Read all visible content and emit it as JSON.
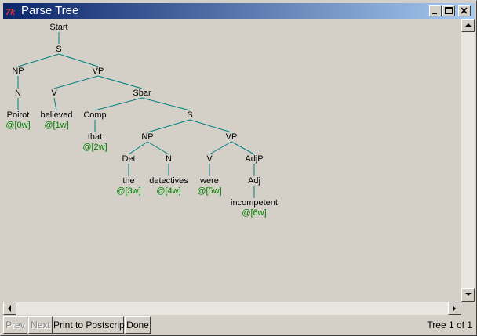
{
  "window": {
    "title": "Parse Tree",
    "app_icon": "tk-feather-icon"
  },
  "tree": {
    "line_color": "#008080",
    "index_color": "#008000",
    "labels": [
      "Start",
      "S",
      "NP",
      "VP",
      "N",
      "V",
      "Sbar",
      "Poirot",
      "believed",
      "Comp",
      "S",
      "that",
      "NP",
      "VP",
      "Det",
      "N",
      "V",
      "AdjP",
      "the",
      "detectives",
      "were",
      "Adj",
      "incompetent"
    ],
    "indices": [
      "@[0w]",
      "@[1w]",
      "@[2w]",
      "@[3w]",
      "@[4w]",
      "@[5w]",
      "@[6w]"
    ]
  },
  "buttons": {
    "prev": "Prev",
    "next": "Next",
    "print": "Print to Postscript",
    "done": "Done"
  },
  "status": "Tree 1 of 1"
}
